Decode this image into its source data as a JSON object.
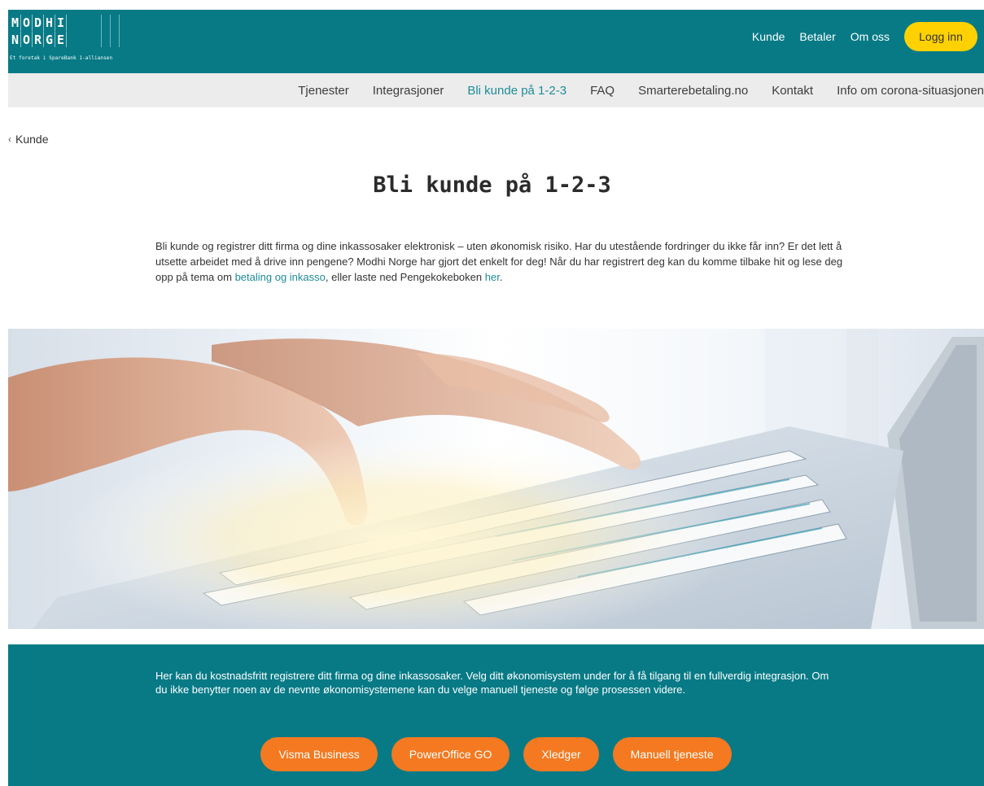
{
  "logo": {
    "row1": [
      "M",
      "O",
      "D",
      "H",
      "I"
    ],
    "row2": [
      "N",
      "O",
      "R",
      "G",
      "E"
    ],
    "tagline": "Et foretak i SpareBank 1-alliansen"
  },
  "topnav": {
    "items": [
      "Kunde",
      "Betaler",
      "Om oss"
    ],
    "login_label": "Logg inn"
  },
  "subnav": {
    "items": [
      "Tjenester",
      "Integrasjoner",
      "Bli kunde på 1-2-3",
      "FAQ",
      "Smarterebetaling.no",
      "Kontakt",
      "Info om corona-situasjonen"
    ],
    "active_index": 2
  },
  "breadcrumb": {
    "chevron": "‹",
    "label": "Kunde"
  },
  "page": {
    "title": "Bli kunde på 1-2-3"
  },
  "intro": {
    "part1": "Bli kunde og registrer ditt firma og dine inkassosaker elektronisk – uten økonomisk risiko. Har du utestående fordringer du ikke får inn? Er det lett å utsette arbeidet med å drive inn pengene? Modhi Norge har gjort det enkelt for deg! Når du har registrert deg kan du komme tilbake hit og lese deg opp på tema om ",
    "link1": "betaling og inkasso",
    "part2": ", eller laste ned Pengekokeboken ",
    "link2": "her",
    "part3": "."
  },
  "cta": {
    "text": "Her kan du kostnadsfritt registrere ditt firma og dine inkassosaker. Velg ditt økonomisystem under for å få tilgang til en fullverdig integrasjon. Om du ikke benytter noen av de nevnte økonomisystemene kan du velge manuell tjeneste og følge prosessen videre.",
    "buttons": [
      "Visma Business",
      "PowerOffice GO",
      "Xledger",
      "Manuell tjeneste"
    ]
  },
  "colors": {
    "brand_teal": "#077a86",
    "login_yellow": "#ffd100",
    "cta_orange": "#f47920",
    "link_teal": "#1d8c98"
  }
}
